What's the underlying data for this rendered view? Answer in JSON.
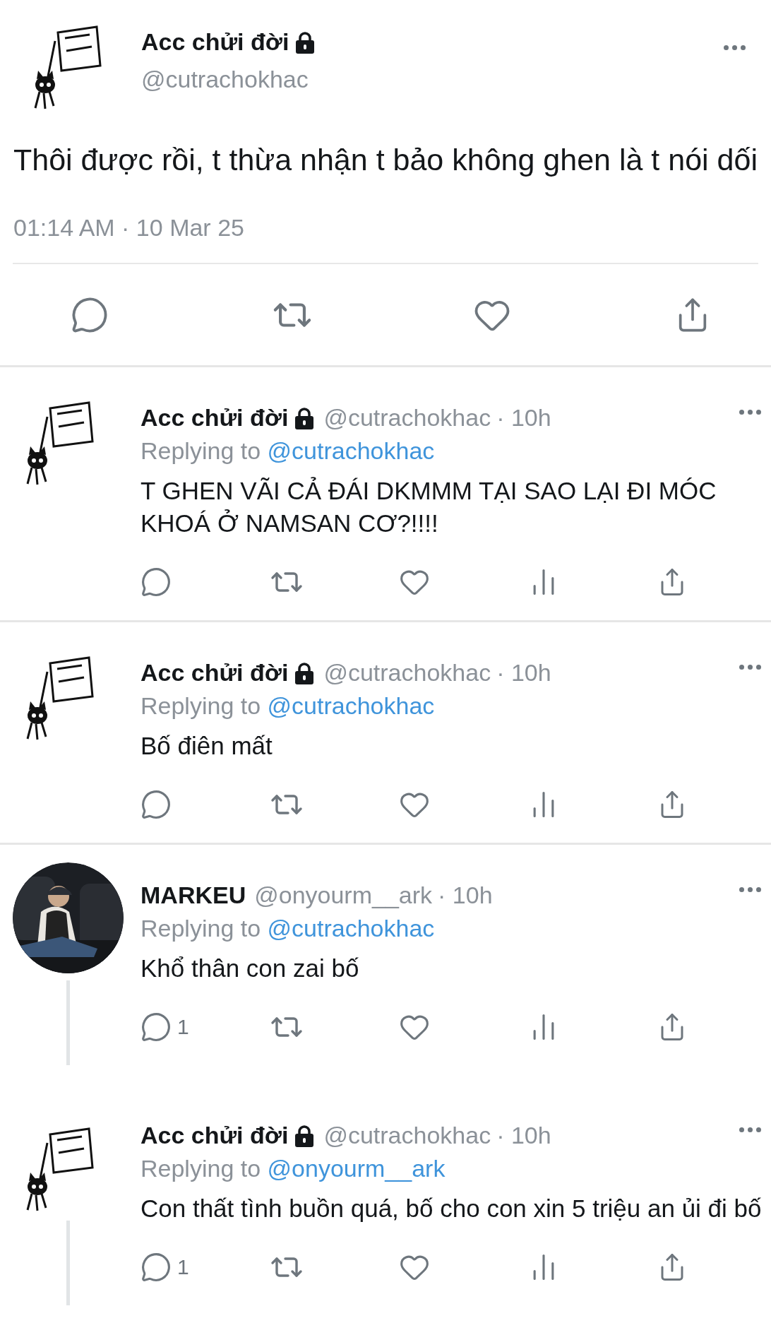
{
  "main_tweet": {
    "author": {
      "name": "Acc chửi đời",
      "handle": "@cutrachokhac",
      "locked": true,
      "avatar": {
        "kind": "sign"
      }
    },
    "text": "Thôi được rồi, t thừa nhận t bảo không ghen là t nói dối",
    "timestamp": "01:14 AM · 10 Mar 25"
  },
  "replies": [
    {
      "name": "Acc chửi đời",
      "handle": "@cutrachokhac",
      "time": "· 10h",
      "locked": true,
      "avatar": {
        "kind": "sign"
      },
      "replying_label": "Replying to",
      "replying_to": "@cutrachokhac",
      "text": "T GHEN VÃI CẢ ĐÁI DKMMM TẠI SAO LẠI ĐI MÓC KHOÁ Ở NAMSAN CƠ?!!!!",
      "connected_below": false
    },
    {
      "name": "Acc chửi đời",
      "handle": "@cutrachokhac",
      "time": "· 10h",
      "locked": true,
      "avatar": {
        "kind": "sign"
      },
      "replying_label": "Replying to",
      "replying_to": "@cutrachokhac",
      "text": "Bố điên mất",
      "connected_below": false
    },
    {
      "name": "MARKEU",
      "handle": "@onyourm__ark",
      "time": "· 10h",
      "locked": false,
      "replying_label": "Replying to",
      "replying_to": "@cutrachokhac",
      "text": "Khổ thân con zai bố",
      "reply_count": "1",
      "connected_below": true
    },
    {
      "name": "Acc chửi đời",
      "handle": "@cutrachokhac",
      "time": "· 10h",
      "locked": true,
      "avatar": {
        "kind": "sign"
      },
      "replying_label": "Replying to",
      "replying_to": "@onyourm__ark",
      "text": "Con thất tình buồn quá, bố cho con xin 5 triệu an ủi đi bố",
      "reply_count": "1",
      "connected_below": true
    }
  ]
}
